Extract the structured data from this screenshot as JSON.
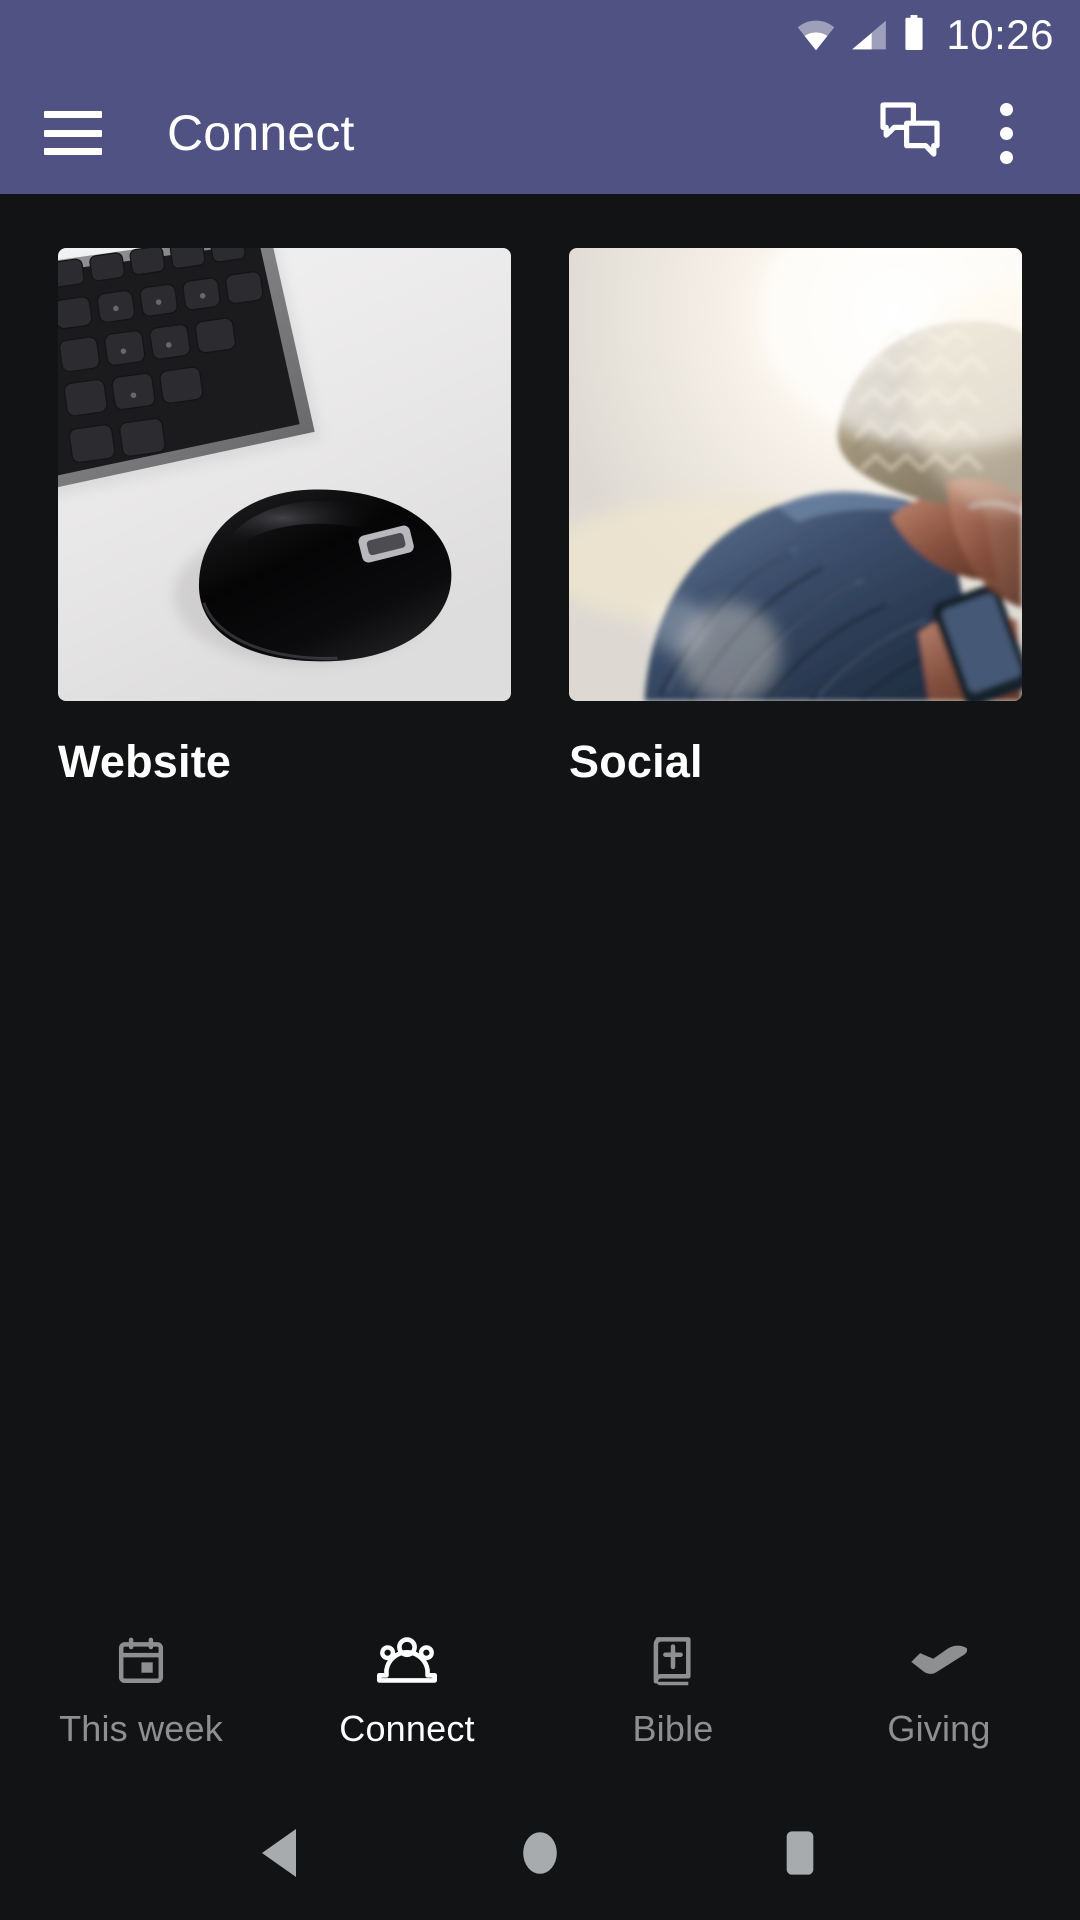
{
  "status_bar": {
    "time": "10:26",
    "icons": [
      "wifi-icon",
      "cellular-signal-icon",
      "battery-icon"
    ],
    "background_color": "#4F5283"
  },
  "app_bar": {
    "title": "Connect",
    "menu_icon": "hamburger-menu-icon",
    "chat_icon": "chat-bubbles-icon",
    "overflow_icon": "more-vertical-icon",
    "background_color": "#4F5283",
    "text_color": "#FFFFFF"
  },
  "main": {
    "background_color": "#111315",
    "cards": [
      {
        "label": "Website",
        "image_description": "black-keyboard-and-wireless-mouse-on-white-desk"
      },
      {
        "label": "Social",
        "image_description": "person-in-knit-beanie-and-blue-puffer-jacket-using-phone-backlit"
      }
    ]
  },
  "bottom_nav": {
    "active_color": "#FFFFFF",
    "inactive_color": "#8D8F91",
    "items": [
      {
        "label": "This week",
        "icon": "calendar-icon",
        "active": false
      },
      {
        "label": "Connect",
        "icon": "people-group-icon",
        "active": true
      },
      {
        "label": "Bible",
        "icon": "book-cross-icon",
        "active": false
      },
      {
        "label": "Giving",
        "icon": "giving-hand-icon",
        "active": false
      }
    ]
  },
  "system_nav": {
    "color": "#A8ABAD",
    "buttons": [
      {
        "name": "back-button",
        "icon": "triangle-back-icon"
      },
      {
        "name": "home-button",
        "icon": "circle-home-icon"
      },
      {
        "name": "recents-button",
        "icon": "square-recents-icon"
      }
    ]
  }
}
